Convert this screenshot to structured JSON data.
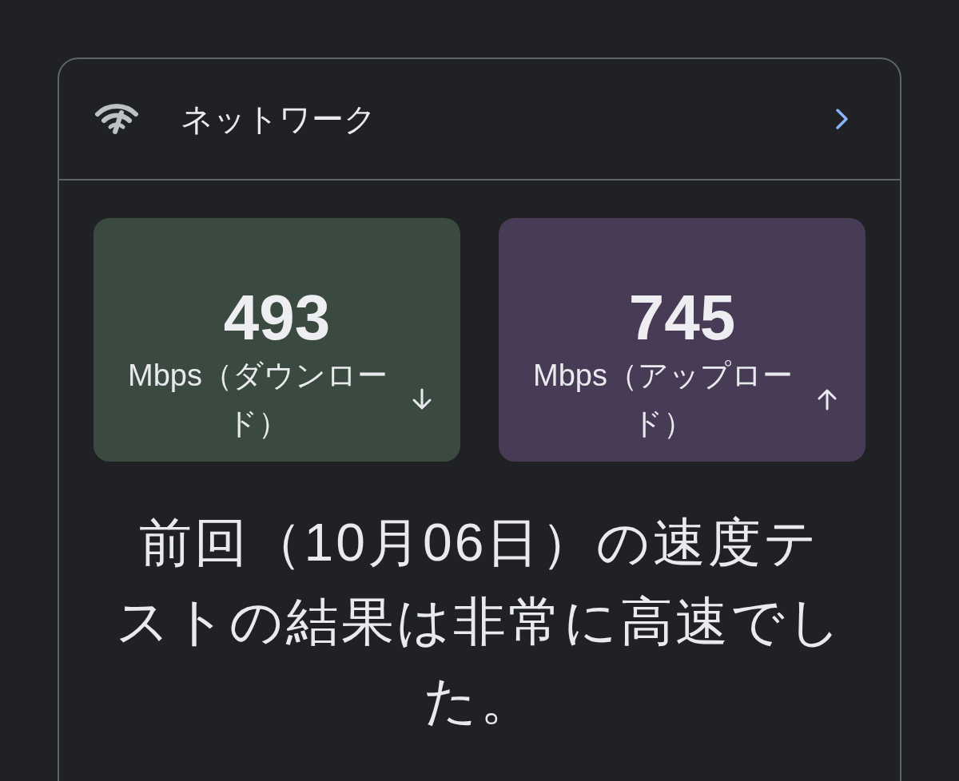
{
  "header": {
    "title": "ネットワーク"
  },
  "speeds": [
    {
      "kind": "download",
      "value": "493",
      "label": "Mbps（ダウンロード）",
      "color": "#3b4a40"
    },
    {
      "kind": "upload",
      "value": "745",
      "label": "Mbps（アップロード）",
      "color": "#483b56"
    }
  ],
  "message": "前回（10月06日）の速度テストの結果は非常に高速でした。"
}
